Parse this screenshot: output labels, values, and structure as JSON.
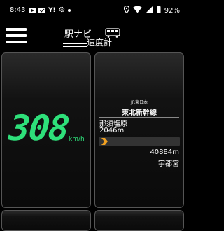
{
  "status": {
    "time": "8:43",
    "carrier_text": "Y!",
    "battery": "92%"
  },
  "header": {
    "logo_line1": "駅ナビ",
    "logo_line2": "速度計"
  },
  "speed": {
    "value": "308",
    "unit": "km/h",
    "color": "#2ee07a"
  },
  "route": {
    "operator": "JR東日本",
    "line": "東北新幹線",
    "current_station": "那須塩原",
    "current_distance": "2046m",
    "next_distance": "40884m",
    "next_station": "宇都宮",
    "progress_fraction": 0.05,
    "arrow_color": "#f0a020"
  }
}
